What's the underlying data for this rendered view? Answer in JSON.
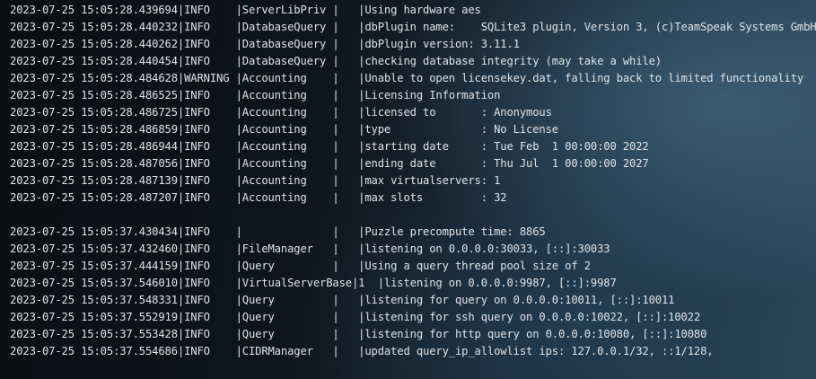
{
  "terminal": {
    "lines": [
      "2023-07-25 15:05:28.439694|INFO    |ServerLibPriv |   |Using hardware aes",
      "2023-07-25 15:05:28.440232|INFO    |DatabaseQuery |   |dbPlugin name:    SQLite3 plugin, Version 3, (c)TeamSpeak Systems GmbH",
      "2023-07-25 15:05:28.440262|INFO    |DatabaseQuery |   |dbPlugin version: 3.11.1",
      "2023-07-25 15:05:28.440454|INFO    |DatabaseQuery |   |checking database integrity (may take a while)",
      "2023-07-25 15:05:28.484628|WARNING |Accounting    |   |Unable to open licensekey.dat, falling back to limited functionality",
      "2023-07-25 15:05:28.486525|INFO    |Accounting    |   |Licensing Information",
      "2023-07-25 15:05:28.486725|INFO    |Accounting    |   |licensed to       : Anonymous",
      "2023-07-25 15:05:28.486859|INFO    |Accounting    |   |type              : No License",
      "2023-07-25 15:05:28.486944|INFO    |Accounting    |   |starting date     : Tue Feb  1 00:00:00 2022",
      "2023-07-25 15:05:28.487056|INFO    |Accounting    |   |ending date       : Thu Jul  1 00:00:00 2027",
      "2023-07-25 15:05:28.487139|INFO    |Accounting    |   |max virtualservers: 1",
      "2023-07-25 15:05:28.487207|INFO    |Accounting    |   |max slots         : 32",
      "",
      "2023-07-25 15:05:37.430434|INFO    |              |   |Puzzle precompute time: 8865",
      "2023-07-25 15:05:37.432460|INFO    |FileManager   |   |listening on 0.0.0.0:30033, [::]:30033",
      "2023-07-25 15:05:37.444159|INFO    |Query         |   |Using a query thread pool size of 2",
      "2023-07-25 15:05:37.546010|INFO    |VirtualServerBase|1  |listening on 0.0.0.0:9987, [::]:9987",
      "2023-07-25 15:05:37.548331|INFO    |Query         |   |listening for query on 0.0.0.0:10011, [::]:10011",
      "2023-07-25 15:05:37.552919|INFO    |Query         |   |listening for ssh query on 0.0.0.0:10022, [::]:10022",
      "2023-07-25 15:05:37.553428|INFO    |Query         |   |listening for http query on 0.0.0.0:10080, [::]:10080",
      "2023-07-25 15:05:37.554686|INFO    |CIDRManager   |   |updated query_ip_allowlist ips: 127.0.0.1/32, ::1/128,"
    ]
  }
}
